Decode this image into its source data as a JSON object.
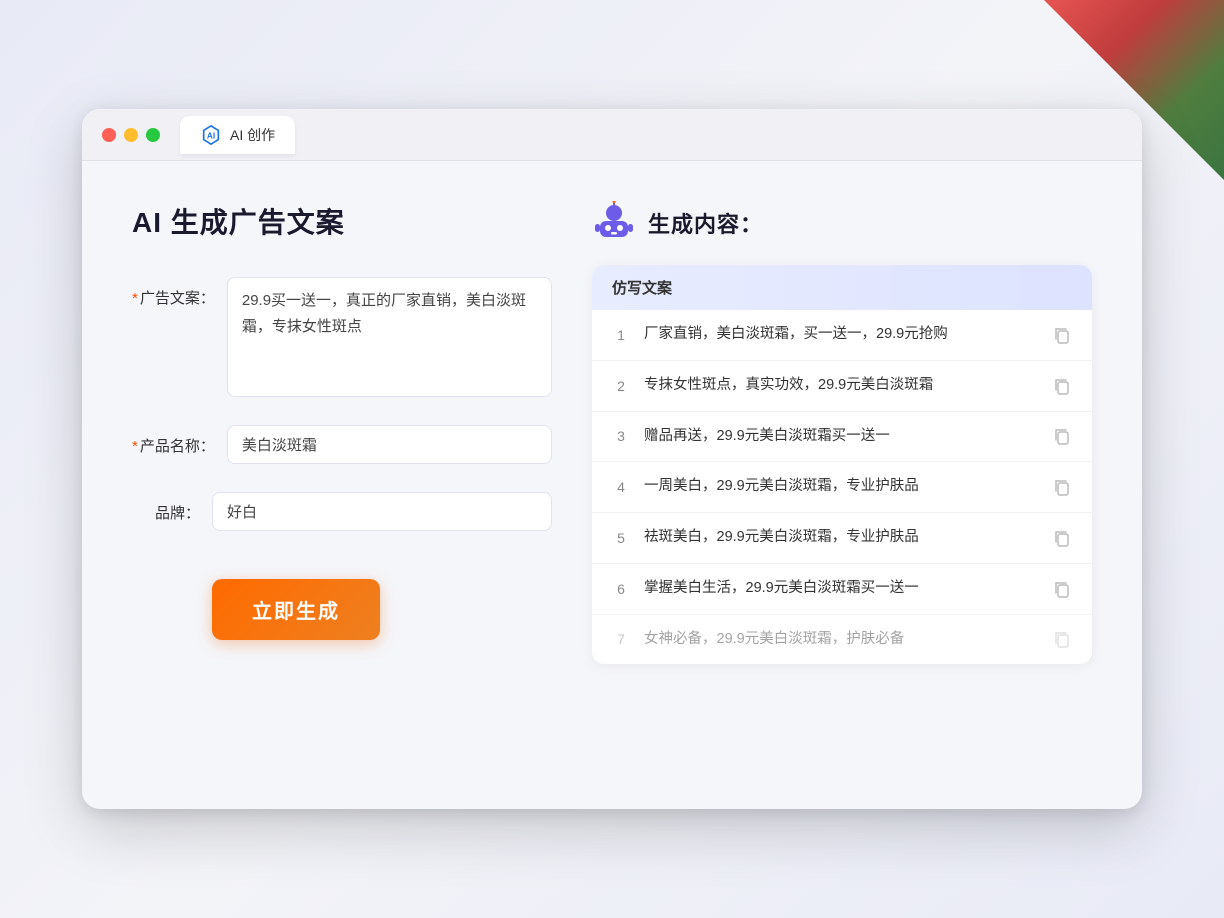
{
  "window": {
    "tab_label": "AI 创作",
    "controls": {
      "close": "close",
      "minimize": "minimize",
      "maximize": "maximize"
    }
  },
  "left": {
    "title": "AI 生成广告文案",
    "fields": [
      {
        "id": "ad_copy",
        "label": "广告文案：",
        "required": true,
        "type": "textarea",
        "value": "29.9买一送一，真正的厂家直销，美白淡斑霜，专抹女性斑点"
      },
      {
        "id": "product_name",
        "label": "产品名称：",
        "required": true,
        "type": "input",
        "value": "美白淡斑霜"
      },
      {
        "id": "brand",
        "label": "品牌：",
        "required": false,
        "type": "input",
        "value": "好白"
      }
    ],
    "generate_btn": "立即生成"
  },
  "right": {
    "title": "生成内容：",
    "table_header": "仿写文案",
    "results": [
      {
        "num": "1",
        "text": "厂家直销，美白淡斑霜，买一送一，29.9元抢购",
        "dimmed": false
      },
      {
        "num": "2",
        "text": "专抹女性斑点，真实功效，29.9元美白淡斑霜",
        "dimmed": false
      },
      {
        "num": "3",
        "text": "赠品再送，29.9元美白淡斑霜买一送一",
        "dimmed": false
      },
      {
        "num": "4",
        "text": "一周美白，29.9元美白淡斑霜，专业护肤品",
        "dimmed": false
      },
      {
        "num": "5",
        "text": "祛斑美白，29.9元美白淡斑霜，专业护肤品",
        "dimmed": false
      },
      {
        "num": "6",
        "text": "掌握美白生活，29.9元美白淡斑霜买一送一",
        "dimmed": false
      },
      {
        "num": "7",
        "text": "女神必备，29.9元美白淡斑霜，护肤必备",
        "dimmed": true
      }
    ]
  },
  "colors": {
    "accent_orange": "#ff6a00",
    "accent_blue": "#5b9cf6",
    "required_red": "#ff4d00"
  }
}
